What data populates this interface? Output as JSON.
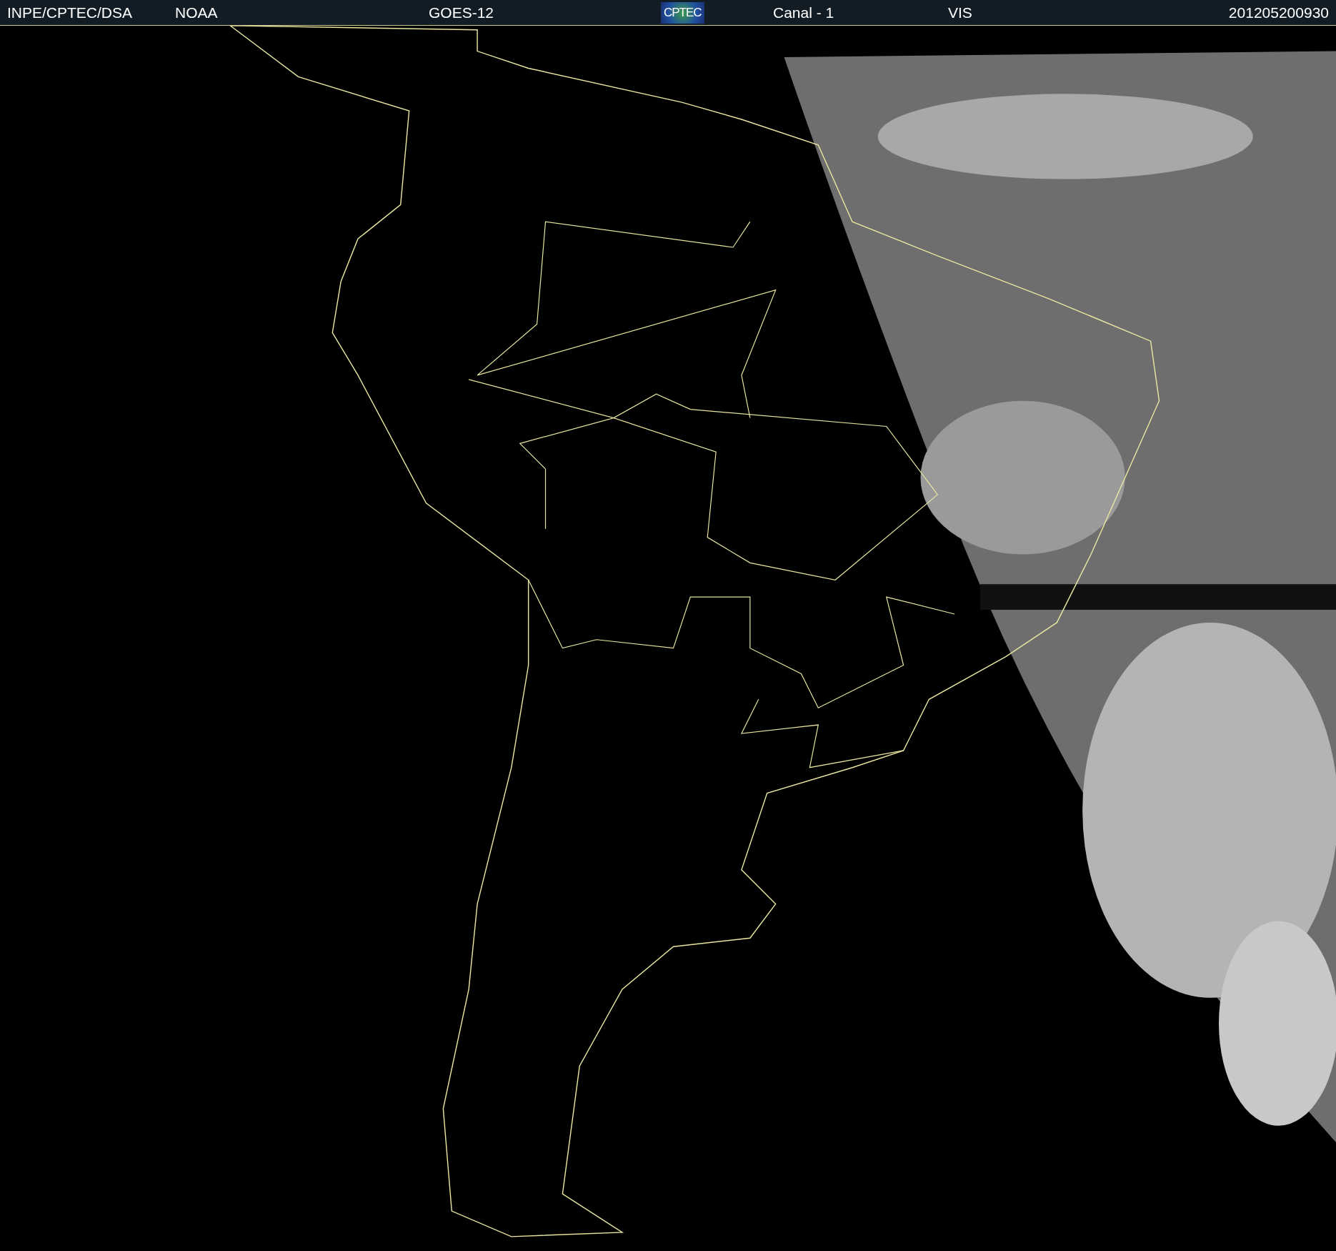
{
  "header": {
    "items": [
      {
        "text": "INPE/CPTEC/DSA",
        "kind": "text"
      },
      {
        "text": "NOAA",
        "kind": "text"
      },
      {
        "text": "GOES-12",
        "kind": "text"
      },
      {
        "text": "CPTEC",
        "kind": "logo"
      },
      {
        "text": "Canal - 1",
        "kind": "text"
      },
      {
        "text": "VIS",
        "kind": "text"
      },
      {
        "text": "201205200930",
        "kind": "text"
      }
    ]
  }
}
